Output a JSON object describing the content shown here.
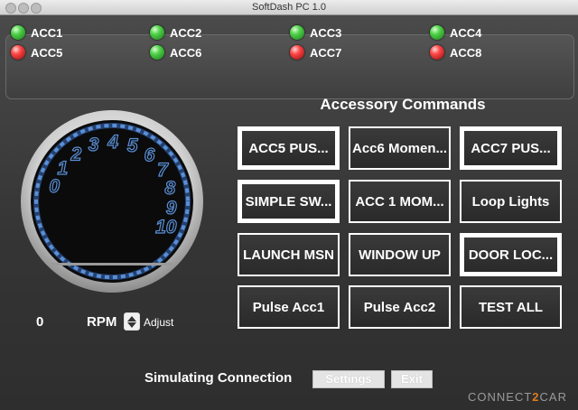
{
  "window": {
    "title": "SoftDash PC 1.0"
  },
  "accessories": [
    {
      "label": "ACC1",
      "state": "on"
    },
    {
      "label": "ACC2",
      "state": "on"
    },
    {
      "label": "ACC3",
      "state": "on"
    },
    {
      "label": "ACC4",
      "state": "on"
    },
    {
      "label": "ACC5",
      "state": "off"
    },
    {
      "label": "ACC6",
      "state": "on"
    },
    {
      "label": "ACC7",
      "state": "off"
    },
    {
      "label": "ACC8",
      "state": "off"
    }
  ],
  "commands": {
    "title": "Accessory Commands",
    "buttons": [
      {
        "label": "ACC5 PUS...",
        "emphasized": true
      },
      {
        "label": "Acc6 Momen...",
        "emphasized": false
      },
      {
        "label": "ACC7 PUS...",
        "emphasized": true
      },
      {
        "label": "SIMPLE SW...",
        "emphasized": true
      },
      {
        "label": "ACC 1 MOM...",
        "emphasized": false
      },
      {
        "label": "Loop Lights",
        "emphasized": false
      },
      {
        "label": "LAUNCH MSN",
        "emphasized": false
      },
      {
        "label": "WINDOW UP",
        "emphasized": false
      },
      {
        "label": "DOOR LOC...",
        "emphasized": true
      },
      {
        "label": "Pulse Acc1",
        "emphasized": false
      },
      {
        "label": "Pulse Acc2",
        "emphasized": false
      },
      {
        "label": "TEST ALL",
        "emphasized": false
      }
    ]
  },
  "gauge": {
    "scale_labels": [
      "0",
      "1",
      "2",
      "3",
      "4",
      "5",
      "6",
      "7",
      "8",
      "9",
      "10"
    ],
    "value": 0,
    "accent": "#5a8fd6"
  },
  "rpm": {
    "value": "0",
    "label": "RPM",
    "adjust_label": "Adjust"
  },
  "footer": {
    "status": "Simulating Connection",
    "settings_label": "Settings",
    "exit_label": "Exit",
    "brand_left": "CONNECT",
    "brand_mid": "2",
    "brand_right": "CAR"
  },
  "colors": {
    "led_on": "#3cc83a",
    "led_off": "#e53030",
    "brand_accent": "#e07a1e"
  }
}
